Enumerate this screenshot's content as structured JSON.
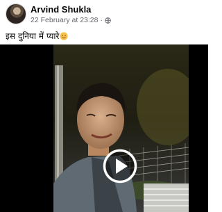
{
  "post": {
    "author": "Arvind Shukla",
    "timestamp": "22 February at 23:28",
    "separator": "·",
    "audience_icon": "globe-icon",
    "text": "इस दुनिया में प्यारे",
    "emoji": "smiling-face-emoji"
  },
  "video": {
    "play_icon": "play-icon"
  },
  "colors": {
    "author_text": "#050505",
    "meta_text": "#65676b",
    "video_background": "#000000",
    "emoji_fill": "#f7c248"
  }
}
